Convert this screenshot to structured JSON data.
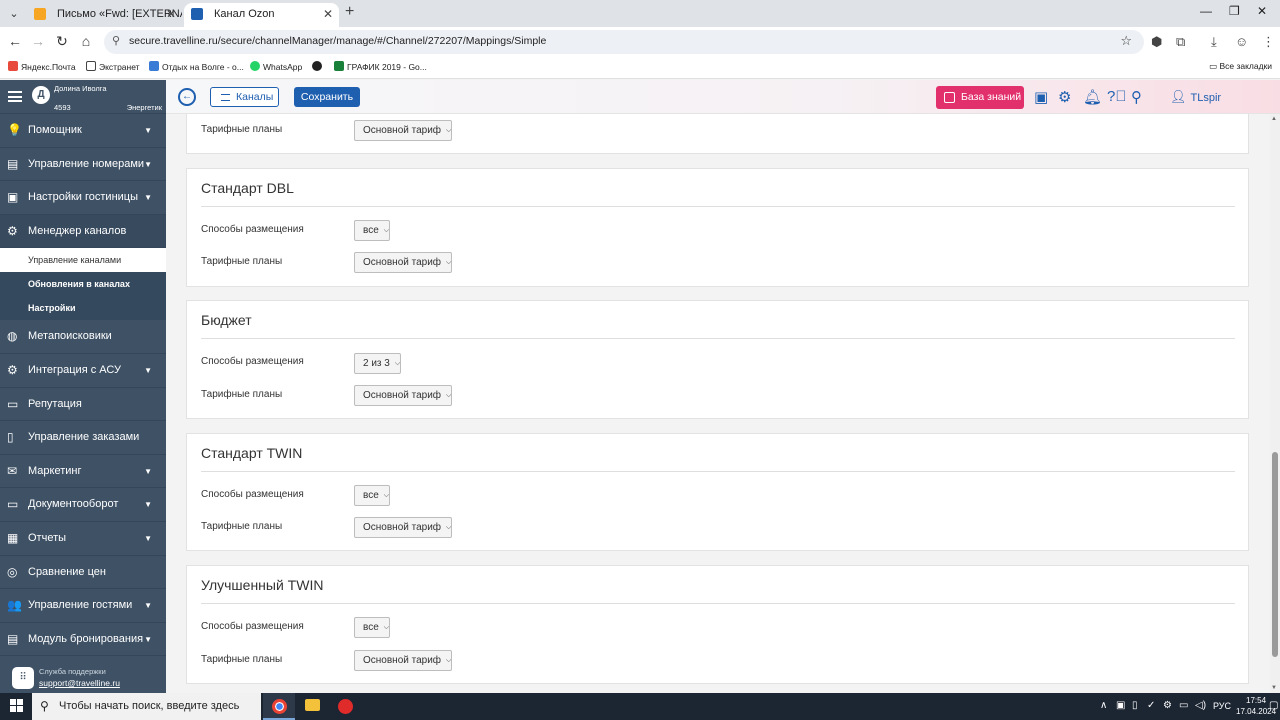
{
  "browser": {
    "tabs": [
      {
        "title": "Письмо «Fwd: [EXTERNAL] Re:",
        "active": false,
        "favicon_color": "#f6a623"
      },
      {
        "title": "Канал Ozon",
        "active": true,
        "favicon_color": "#1f5fb0"
      }
    ],
    "url": "secure.travelline.ru/secure/channelManager/manage/#/Channel/272207/Mappings/Simple",
    "bookmarks": [
      {
        "label": "Яндекс.Почта",
        "color": "#e84b3c"
      },
      {
        "label": "Экстранет",
        "color": "#444444"
      },
      {
        "label": "Отдых на Волге - о...",
        "color": "#3a7bd5"
      },
      {
        "label": "WhatsApp",
        "color": "#25d366"
      },
      {
        "label": "",
        "color": "#222222"
      },
      {
        "label": "ГРАФИК 2019 - Go...",
        "color": "#188038"
      }
    ],
    "all_bookmarks": "Все закладки"
  },
  "sidebar": {
    "hotel_name": "Долина Иволга",
    "hotel_id": "4593",
    "hotel_city": "Энергетик",
    "items": [
      {
        "label": "Помощник",
        "icon": "💡",
        "chevron": true
      },
      {
        "label": "Управление номерами",
        "icon": "▤",
        "chevron": true
      },
      {
        "label": "Настройки гостиницы",
        "icon": "▣",
        "chevron": true
      },
      {
        "label": "Менеджер каналов",
        "icon": "⚙",
        "chevron": false
      }
    ],
    "subitems": [
      {
        "label": "Управление каналами"
      },
      {
        "label": "Обновления в каналах"
      },
      {
        "label": "Настройки"
      }
    ],
    "items2": [
      {
        "label": "Метапоисковики",
        "icon": "◍",
        "chevron": false
      },
      {
        "label": "Интеграция с АСУ",
        "icon": "⚙",
        "chevron": true
      },
      {
        "label": "Репутация",
        "icon": "▭",
        "chevron": false
      },
      {
        "label": "Управление заказами",
        "icon": "▯",
        "chevron": false
      },
      {
        "label": "Маркетинг",
        "icon": "✉",
        "chevron": true
      },
      {
        "label": "Документооборот",
        "icon": "▭",
        "chevron": true
      },
      {
        "label": "Отчеты",
        "icon": "▦",
        "chevron": true
      },
      {
        "label": "Сравнение цен",
        "icon": "◎",
        "chevron": false
      },
      {
        "label": "Управление гостями",
        "icon": "👥",
        "chevron": true
      },
      {
        "label": "Модуль бронирования",
        "icon": "▤",
        "chevron": true
      }
    ],
    "support_label": "Служба поддержки",
    "support_email": "support@travelline.ru"
  },
  "topbar": {
    "channels_label": "Каналы",
    "save_label": "Сохранить",
    "kb_label": "База знаний",
    "user": "TLspir"
  },
  "labels": {
    "placement": "Способы размещения",
    "rate_plans": "Тарифные планы"
  },
  "partial_card": {
    "rate_value": "Основной тариф"
  },
  "cards": [
    {
      "title": "Стандарт DBL",
      "placement_value": "все",
      "rate_value": "Основной тариф"
    },
    {
      "title": "Бюджет",
      "placement_value": "2 из 3",
      "rate_value": "Основной тариф"
    },
    {
      "title": "Стандарт TWIN",
      "placement_value": "все",
      "rate_value": "Основной тариф"
    },
    {
      "title": "Улучшенный TWIN",
      "placement_value": "все",
      "rate_value": "Основной тариф"
    }
  ],
  "taskbar": {
    "search_placeholder": "Чтобы начать поиск, введите здесь запрос",
    "language": "РУС",
    "time": "17:54",
    "date": "17.04.2024"
  }
}
